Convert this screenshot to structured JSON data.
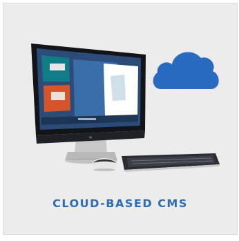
{
  "card": {
    "caption": "CLOUD-BASED CMS",
    "icons": {
      "cloud": "cloud-icon",
      "monitor": "desktop-monitor-icon",
      "keyboard": "keyboard-icon",
      "mouse": "mouse-icon"
    }
  },
  "colors": {
    "caption": "#2e6db3",
    "cloud": "#2a6bc2",
    "tile_background": "#ececec"
  }
}
